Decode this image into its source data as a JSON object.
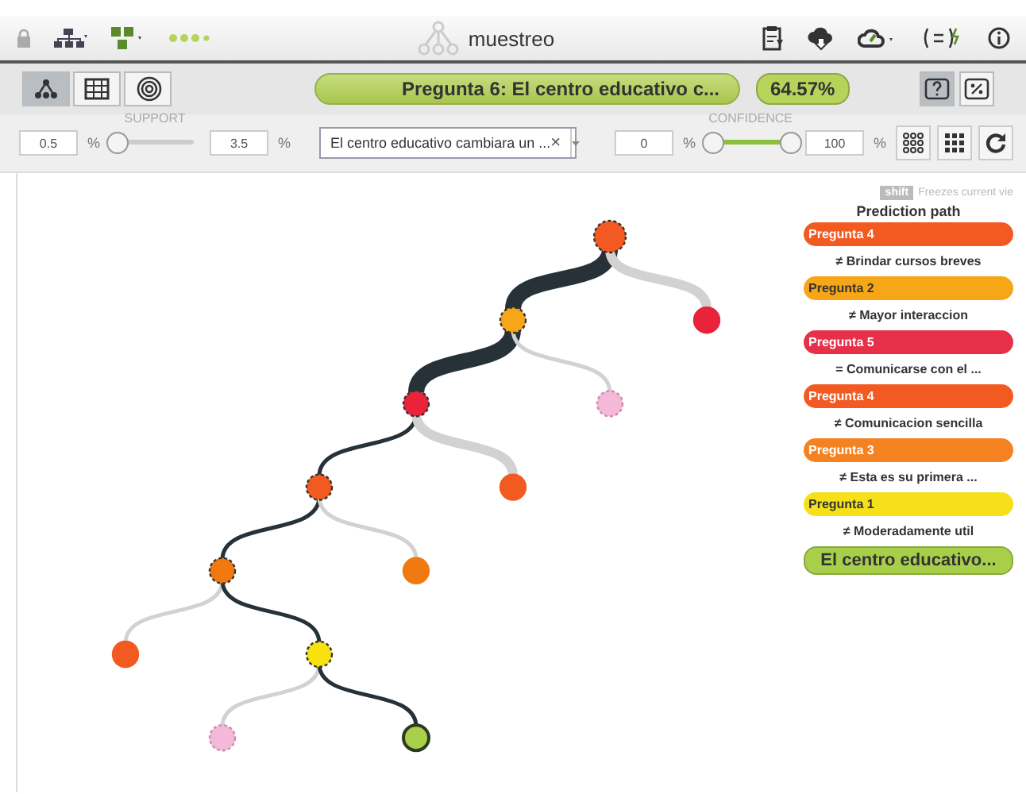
{
  "toolbar": {
    "app_name": "muestreo"
  },
  "view_buttons": [
    {
      "kind": "tree",
      "selected": true
    },
    {
      "kind": "table",
      "selected": false
    },
    {
      "kind": "rings",
      "selected": false
    }
  ],
  "prediction": {
    "label": "Pregunta 6: El centro educativo c...",
    "confidence": "64.57%"
  },
  "mode_buttons": [
    {
      "kind": "question",
      "selected": true
    },
    {
      "kind": "percent",
      "selected": false
    }
  ],
  "support": {
    "label": "SUPPORT",
    "min": "0.5",
    "min_unit": "%",
    "max": "3.5",
    "max_unit": "%",
    "level": 0
  },
  "field_filter": {
    "value": "El centro educativo cambiara un ...",
    "clear": "×"
  },
  "confidence_filter": {
    "label": "CONFIDENCE",
    "min": "0",
    "min_unit": "%",
    "max": "100",
    "max_unit": "%",
    "level": 1
  },
  "legend": {
    "key": "shift",
    "hint": "Freezes current vie",
    "title": "Prediction path",
    "steps": [
      {
        "kind": "question",
        "text": "Pregunta 4",
        "color": "#f25a22"
      },
      {
        "kind": "condition",
        "text": "≠ Brindar cursos breves"
      },
      {
        "kind": "question",
        "text": "Pregunta 2",
        "color": "#f7a617"
      },
      {
        "kind": "condition",
        "text": "≠ Mayor interaccion"
      },
      {
        "kind": "question",
        "text": "Pregunta 5",
        "color": "#e8304a"
      },
      {
        "kind": "condition",
        "text": "= Comunicarse con el ..."
      },
      {
        "kind": "question",
        "text": "Pregunta 4",
        "color": "#f25a22"
      },
      {
        "kind": "condition",
        "text": "≠ Comunicacion sencilla"
      },
      {
        "kind": "question",
        "text": "Pregunta 3",
        "color": "#f58220"
      },
      {
        "kind": "condition",
        "text": "≠ Esta es su primera ..."
      },
      {
        "kind": "question",
        "text": "Pregunta 1",
        "color": "#f5e01a"
      },
      {
        "kind": "condition",
        "text": "≠ Moderadamente util"
      },
      {
        "kind": "result",
        "text": "El centro educativo...",
        "color": "#a8cf4a"
      }
    ]
  },
  "tree": {
    "color": "#f25a22",
    "on_path": true,
    "children": [
      {
        "color": "#f7a617",
        "on_path": true,
        "kind": "heavy",
        "children": [
          {
            "color": "#e8233a",
            "on_path": true,
            "kind": "heavy",
            "children": [
              {
                "color": "#f25a22",
                "on_path": true,
                "kind": "thin",
                "children": [
                  {
                    "color": "#f07a10",
                    "on_path": true,
                    "kind": "thin",
                    "children": [
                      {
                        "color": "#f25a22",
                        "on_path": false,
                        "kind": "thin"
                      },
                      {
                        "color": "#f7e10f",
                        "on_path": true,
                        "kind": "thin",
                        "children": [
                          {
                            "color": "#f4b8d8",
                            "on_path": false,
                            "kind": "thin"
                          },
                          {
                            "color": "#a8d04a",
                            "on_path": true,
                            "kind": "thin",
                            "leaf_result": true
                          }
                        ]
                      }
                    ]
                  },
                  {
                    "color": "#f07a10",
                    "on_path": false,
                    "kind": "thin"
                  }
                ]
              },
              {
                "color": "#f25a22",
                "on_path": false,
                "kind": "medium"
              }
            ]
          },
          {
            "color": "#f4b8d8",
            "on_path": false,
            "kind": "thin"
          }
        ]
      },
      {
        "color": "#e8233a",
        "on_path": false,
        "kind": "medium"
      }
    ]
  }
}
